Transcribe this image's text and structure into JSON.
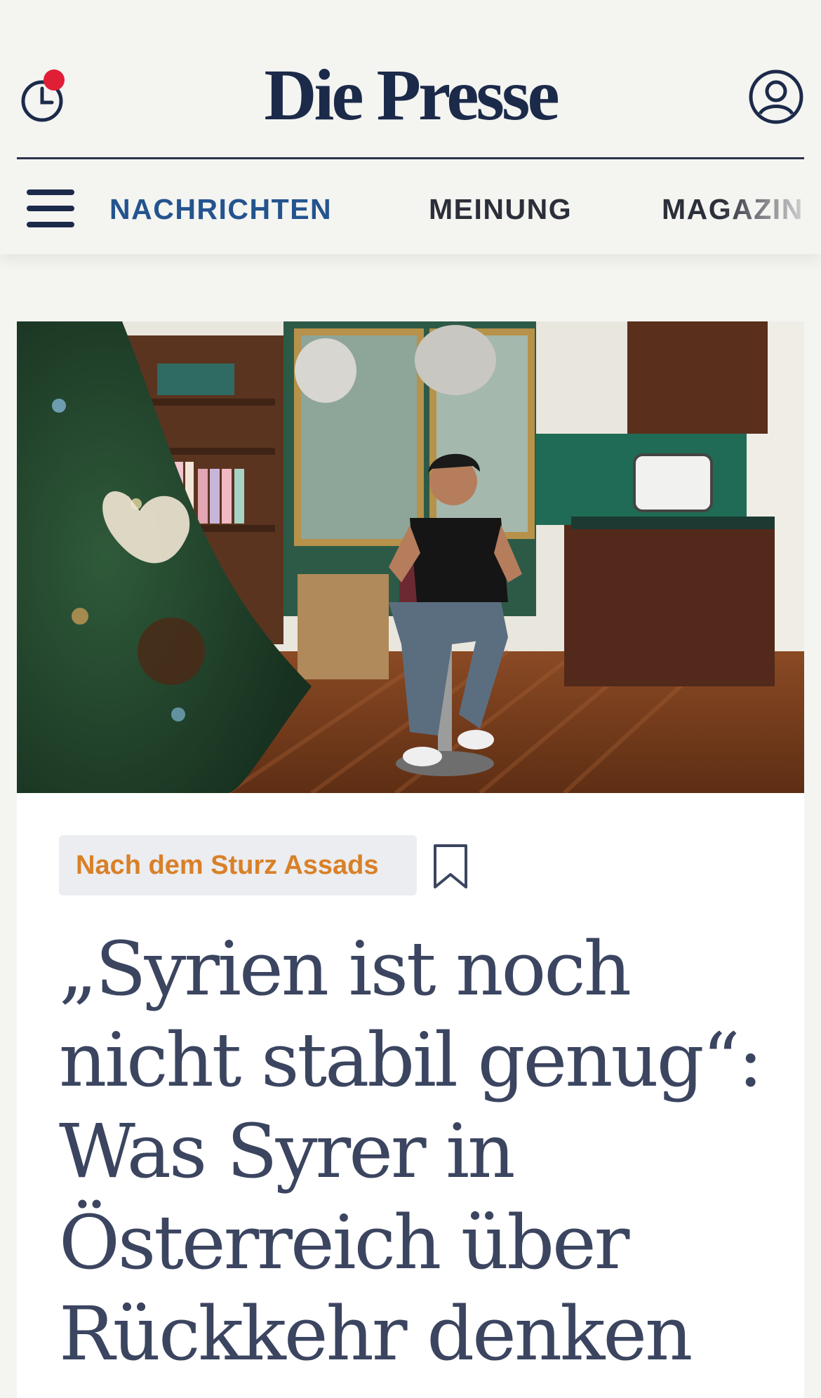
{
  "header": {
    "logo_text": "Die Presse",
    "history_icon": "history-clock-icon",
    "account_icon": "user-account-icon",
    "notification_dot_color": "#e01e36",
    "brand_color": "#1c2a4a"
  },
  "nav": {
    "menu_icon": "hamburger-menu-icon",
    "items": [
      {
        "label": "NACHRICHTEN",
        "active": true
      },
      {
        "label": "MEINUNG",
        "active": false
      },
      {
        "label": "MAGAZIN",
        "active": false
      }
    ],
    "active_color": "#23548e"
  },
  "article": {
    "tag": "Nach dem Sturz Assads",
    "tag_color": "#d98027",
    "bookmark_icon": "bookmark-icon",
    "headline_lines": [
      "„Syrien ist noch",
      "nicht stabil genug“:",
      "Was Syrer in",
      "Österreich über",
      "Rückkehr denken"
    ],
    "headline_color": "#3b4560"
  }
}
